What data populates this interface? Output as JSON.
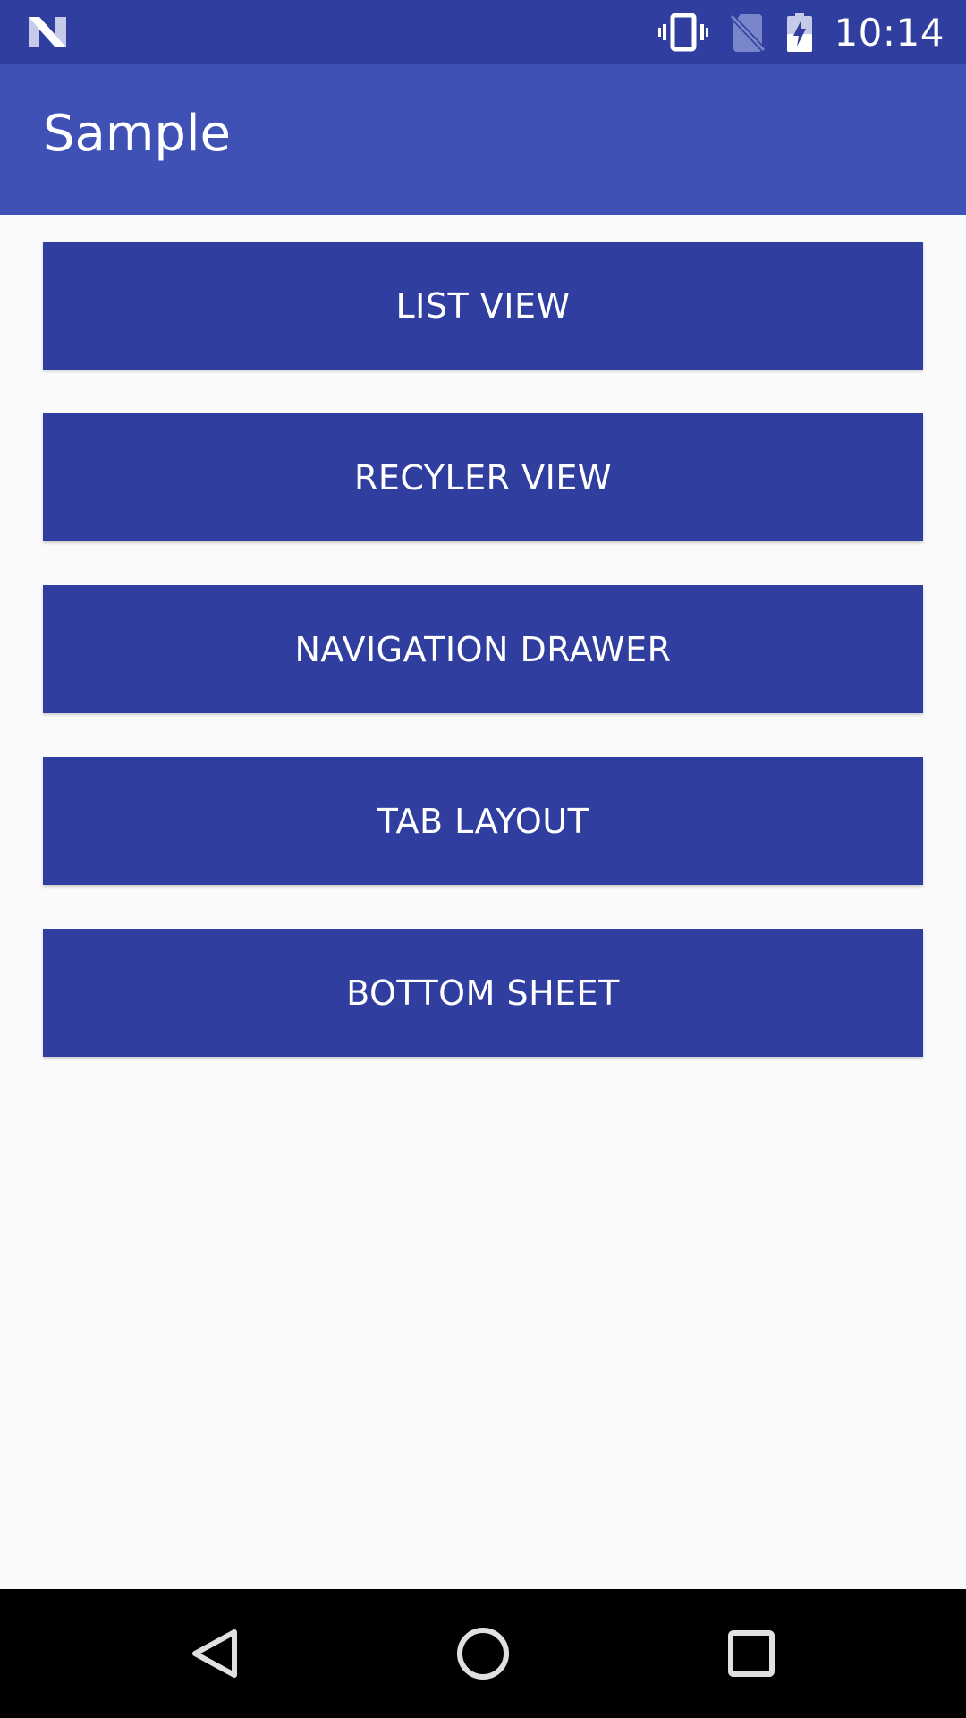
{
  "status_bar": {
    "time": "10:14",
    "icons": [
      "android-n-icon",
      "vibrate-icon",
      "no-sim-icon",
      "battery-charging-icon"
    ],
    "background_color": "#303f9f"
  },
  "app_bar": {
    "title": "Sample",
    "background_color": "#3f51b5"
  },
  "buttons": [
    {
      "label": "LIST VIEW"
    },
    {
      "label": "RECYLER VIEW"
    },
    {
      "label": "NAVIGATION DRAWER"
    },
    {
      "label": "TAB LAYOUT"
    },
    {
      "label": "BOTTOM SHEET"
    }
  ],
  "button_color": "#303f9f",
  "navigation_bar": {
    "icons": [
      "back-icon",
      "home-icon",
      "recents-icon"
    ]
  }
}
